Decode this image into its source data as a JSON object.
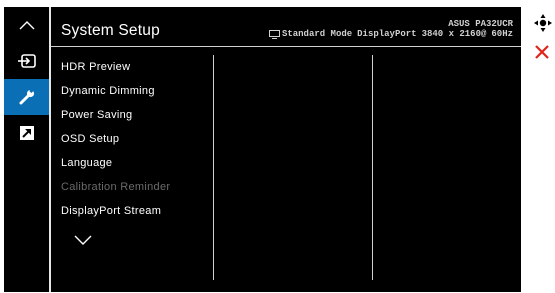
{
  "menu_title": "System Setup",
  "model": "ASUS PA32UCR",
  "mode": "Standard Mode",
  "input": "DisplayPort",
  "resolution": "3840 x 2160@",
  "refresh": "60Hz",
  "menu_items": [
    {
      "label": "HDR Preview",
      "enabled": true
    },
    {
      "label": "Dynamic Dimming",
      "enabled": true
    },
    {
      "label": "Power Saving",
      "enabled": true
    },
    {
      "label": "OSD Setup",
      "enabled": true
    },
    {
      "label": "Language",
      "enabled": true
    },
    {
      "label": "Calibration Reminder",
      "enabled": false
    },
    {
      "label": "DisplayPort Stream",
      "enabled": true
    }
  ],
  "rail_icons": [
    "chevron-up-icon",
    "input-select-icon",
    "wrench-icon",
    "shortcut-icon"
  ],
  "active_rail_icon": "wrench-icon",
  "side_icons": [
    "navigation-joystick-icon",
    "close-icon"
  ],
  "colors": {
    "accent": "#0a6fb4",
    "close": "#e2231a",
    "disabled": "#6a6a6a"
  }
}
